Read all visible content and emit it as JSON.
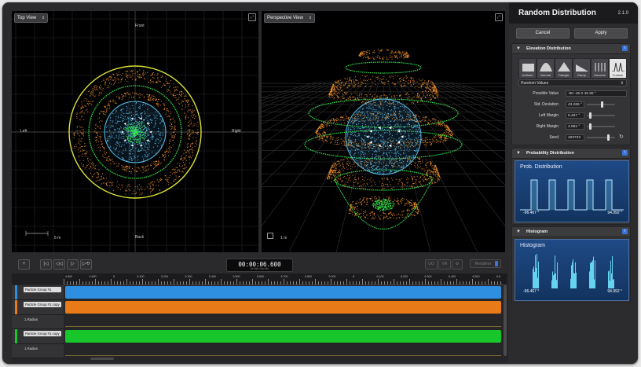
{
  "viewports": {
    "top": {
      "selector": "Top View",
      "labels": {
        "front": "Front",
        "back": "Back",
        "left": "Left",
        "right": "Right"
      },
      "scale": "5 m"
    },
    "perspective": {
      "selector": "Perspective View",
      "scale": "1 m"
    }
  },
  "panel": {
    "title": "Random Distribution",
    "version": "2.1.0",
    "cancel": "Cancel",
    "apply": "Apply",
    "elevation": {
      "title": "Elevation Distribution",
      "types": [
        "Uniform",
        "Normal",
        "Triangle",
        "Ramp",
        "Discrete",
        "Custom"
      ],
      "selected_type": "Custom",
      "mode": "Random Values",
      "rows": [
        {
          "label": "Possible Value",
          "value": "-90 -45 0 45 90 °"
        },
        {
          "label": "Std. Deviation",
          "value": "43.266 °",
          "slider": 0.55
        },
        {
          "label": "Left Margin",
          "value": "6.467 °",
          "slider": 0.1
        },
        {
          "label": "Right Margin",
          "value": "4.992 °",
          "slider": 0.08
        },
        {
          "label": "Seed",
          "value": "493733",
          "slider": 0.78
        }
      ]
    },
    "probability": {
      "title": "Probability Distribution",
      "graph_title": "Prob. Distribution",
      "min": "-96.467 °",
      "max": "94.992 °"
    },
    "histogram": {
      "title": "Histogram",
      "graph_title": "Histogram",
      "min": "-96.467 °",
      "max": "94.992 °"
    }
  },
  "transport": {
    "timecode": "00:00:06.600",
    "units": "Hr  Min  Sec  Ms",
    "btn_uo": "UO",
    "btn_vr": "VR",
    "renderer": "Renderer"
  },
  "timeline": {
    "ticks": [
      "4.800",
      "4.900",
      "5",
      "5.100",
      "5.200",
      "5.300",
      "5.400",
      "5.500",
      "5.600",
      "5.700",
      "5.800",
      "5.900",
      "6",
      "6.100",
      "6.200",
      "6.300",
      "6.400",
      "6.500",
      "6.6"
    ],
    "tracks": [
      {
        "name": "Particle Group #1",
        "color": "#2e8fe0"
      },
      {
        "name": "Particle Group #1 copy",
        "color": "#e87b17"
      },
      {
        "sub": "1.Radius"
      },
      {
        "name": "Particle Group #1 copy",
        "color": "#17c62a"
      },
      {
        "sub": "1.Radius"
      }
    ]
  },
  "colors": {
    "blue_particles": "#5bc3ef",
    "orange_particles": "#e98a24",
    "green_rings": "#2ee04a",
    "yellow_ring": "#d9e033",
    "accent_blue": "#3a73d9"
  }
}
